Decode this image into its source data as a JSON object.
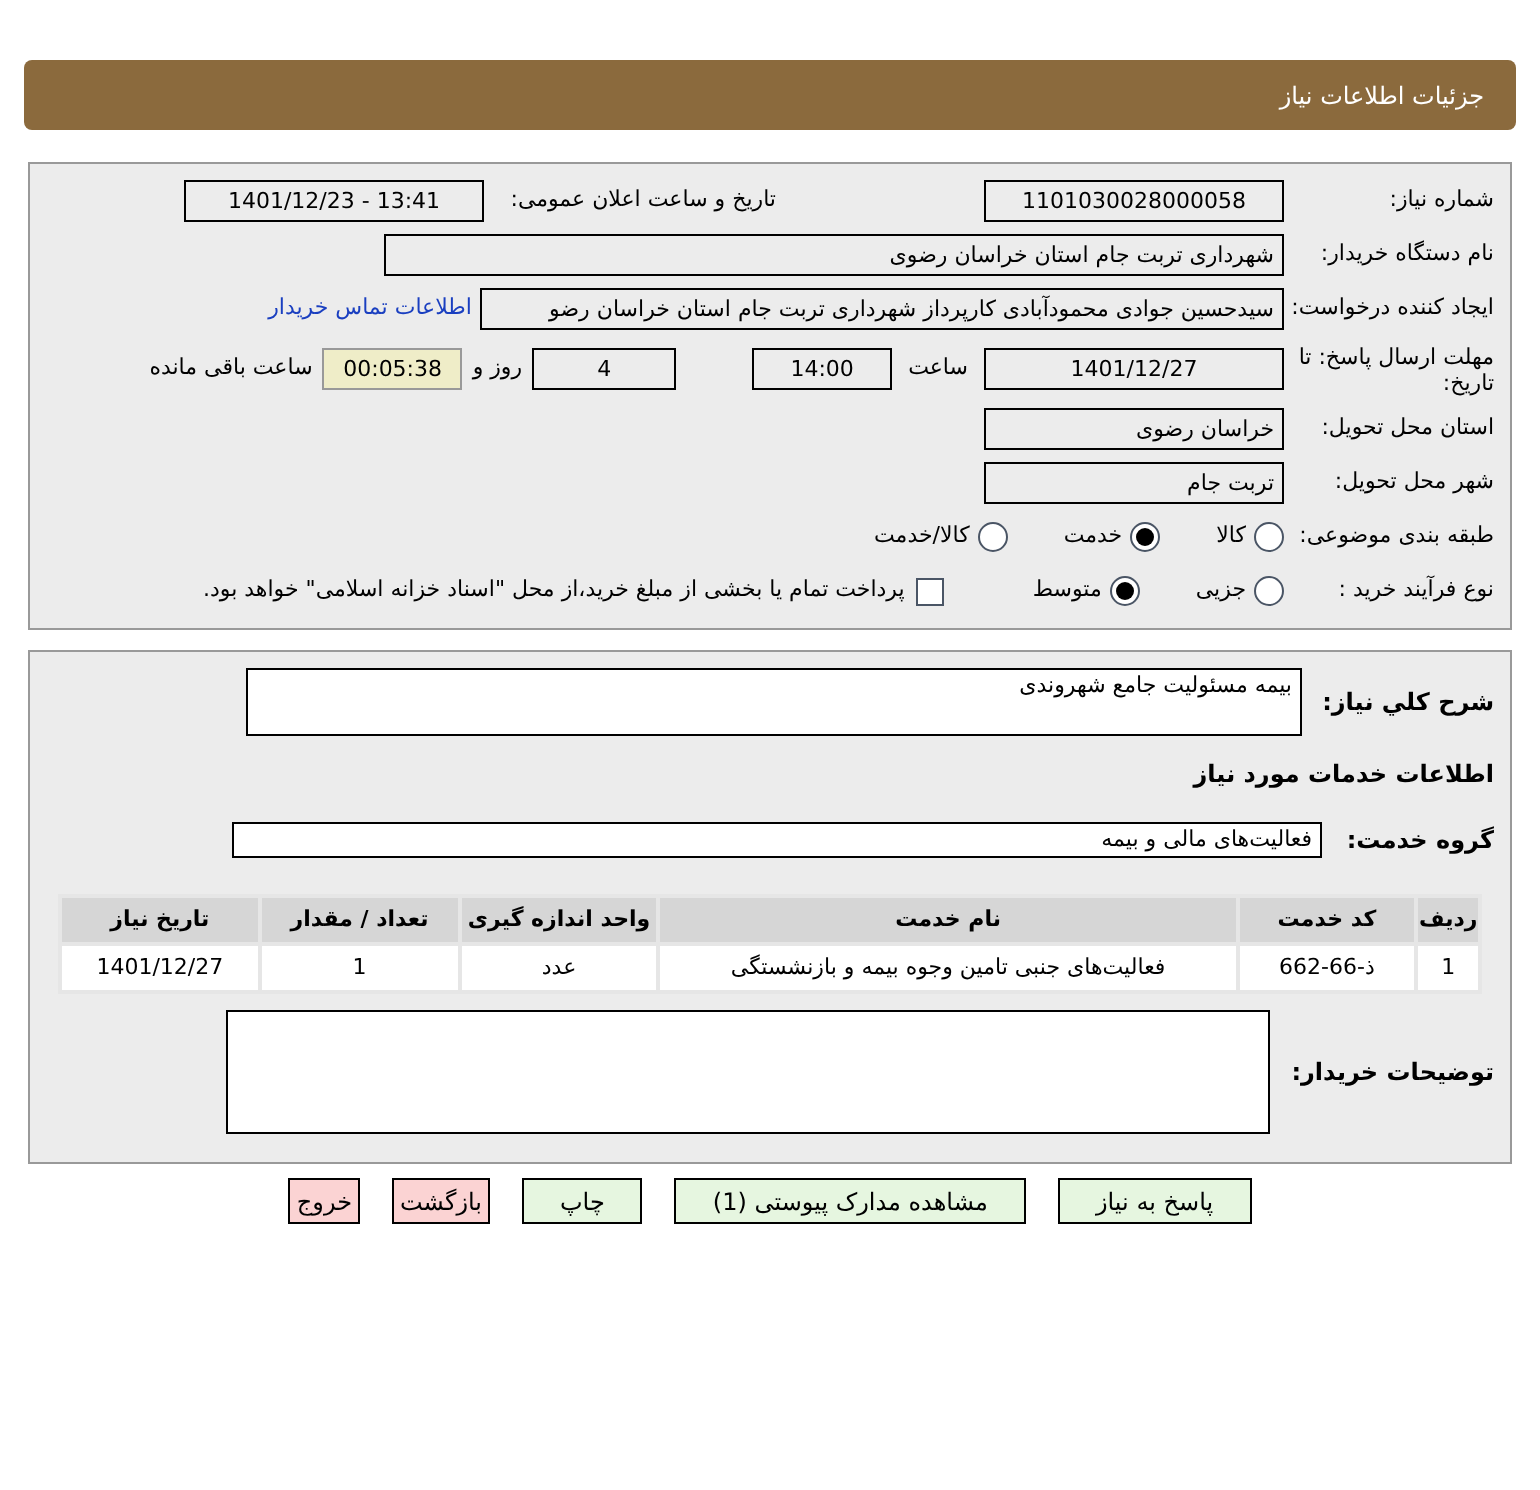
{
  "header": {
    "title": "جزئیات اطلاعات نیاز"
  },
  "details": {
    "need_number": {
      "label": "شماره نیاز:",
      "value": "1101030028000058"
    },
    "announce": {
      "label": "تاریخ و ساعت اعلان عمومی:",
      "value": "1401/12/23 - 13:41"
    },
    "buyer_org": {
      "label": "نام دستگاه خریدار:",
      "value": "شهرداری تربت جام استان خراسان رضوی"
    },
    "requester": {
      "label": "ایجاد کننده درخواست:",
      "value": "سیدحسین جوادی محمودآبادی کارپرداز شهرداری تربت جام استان خراسان رضو",
      "link": "اطلاعات تماس خریدار"
    },
    "deadline": {
      "label": "مهلت ارسال پاسخ: تا تاریخ:",
      "date": "1401/12/27",
      "time_label": "ساعت",
      "time": "14:00",
      "days": "4",
      "days_label": "روز و",
      "remaining": "00:05:38",
      "remaining_label": "ساعت باقی مانده"
    },
    "province": {
      "label": "استان محل تحویل:",
      "value": "خراسان رضوی"
    },
    "city": {
      "label": "شهر محل تحویل:",
      "value": "تربت جام"
    },
    "category": {
      "label": "طبقه بندی موضوعی:",
      "options": [
        {
          "label": "کالا",
          "selected": false
        },
        {
          "label": "خدمت",
          "selected": true
        },
        {
          "label": "کالا/خدمت",
          "selected": false
        }
      ]
    },
    "purchase_type": {
      "label": "نوع فرآیند خرید :",
      "options": [
        {
          "label": "جزیی",
          "selected": false
        },
        {
          "label": "متوسط",
          "selected": true
        }
      ],
      "payment_checkbox": {
        "label": "پرداخت تمام یا بخشی از مبلغ خرید،از محل \"اسناد خزانه اسلامی\" خواهد بود.",
        "checked": false
      }
    }
  },
  "services": {
    "summary": {
      "label": "شرح کلي نياز:",
      "value": "بیمه مسئولیت جامع شهروندی"
    },
    "section_title": "اطلاعات خدمات مورد نیاز",
    "group": {
      "label": "گروه خدمت:",
      "value": "فعالیت‌های مالی و بیمه"
    },
    "table": {
      "columns": [
        "ردیف",
        "کد خدمت",
        "نام خدمت",
        "واحد اندازه گیری",
        "تعداد / مقدار",
        "تاریخ نیاز"
      ],
      "rows": [
        [
          "1",
          "ذ-66-662",
          "فعالیت‌های جنبی تامین وجوه بیمه و بازنشستگی",
          "عدد",
          "1",
          "1401/12/27"
        ]
      ]
    },
    "buyer_notes": {
      "label": "توضیحات خریدار:"
    }
  },
  "buttons": [
    {
      "label": "پاسخ به نیاز",
      "kind": "primary"
    },
    {
      "label": "مشاهده مدارک پیوستی (1)",
      "kind": "primary"
    },
    {
      "label": "چاپ",
      "kind": "primary"
    },
    {
      "label": "بازگشت",
      "kind": "danger"
    },
    {
      "label": "خروج",
      "kind": "danger"
    }
  ]
}
